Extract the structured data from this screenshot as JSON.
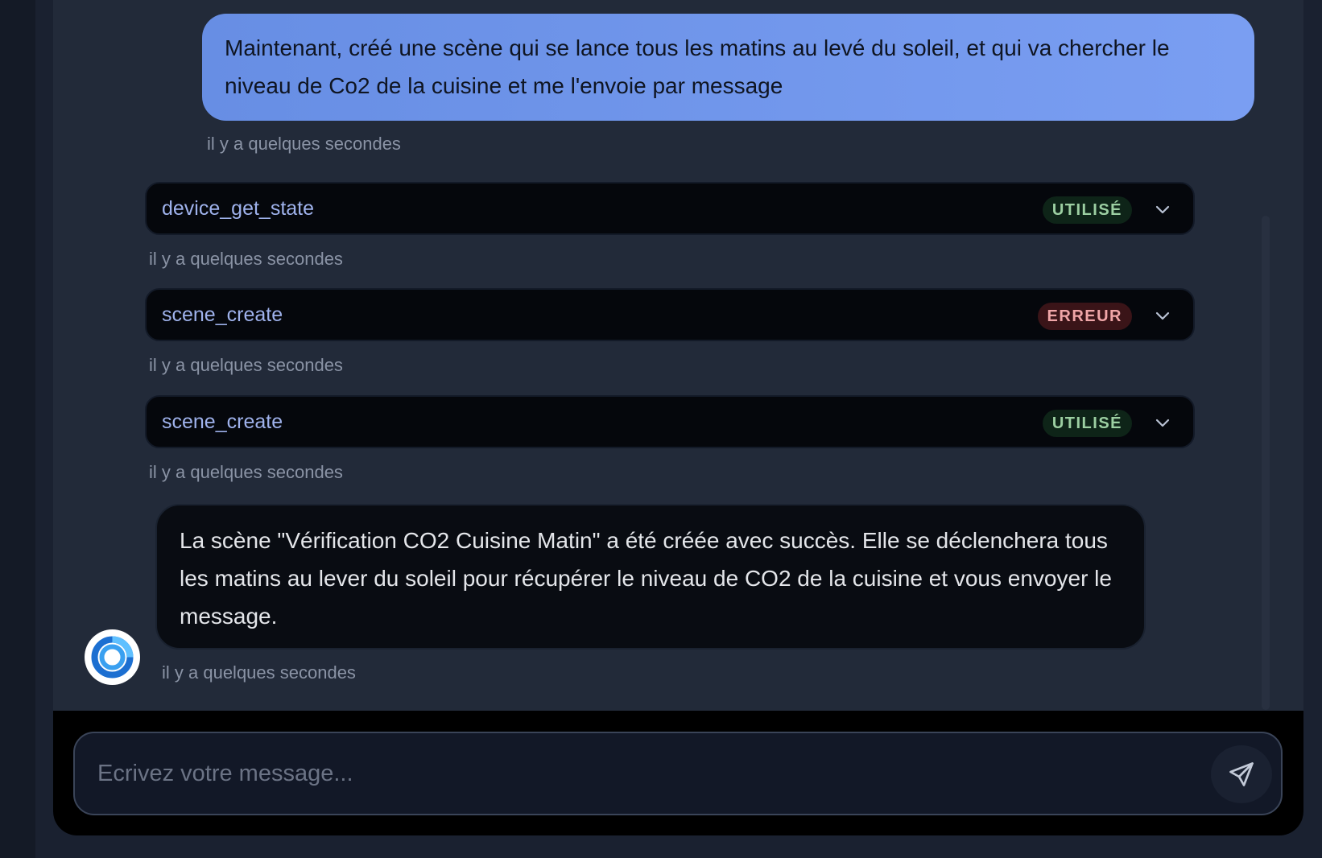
{
  "messages": {
    "user_text": "Maintenant, créé une scène qui se lance tous les matins au levé du soleil, et qui va chercher le niveau de Co2 de la cuisine et me l'envoie par message",
    "user_time": "il y a quelques secondes",
    "tools": [
      {
        "name": "device_get_state",
        "status": "UTILISÉ",
        "time": "il y a quelques secondes"
      },
      {
        "name": "scene_create",
        "status": "ERREUR",
        "time": "il y a quelques secondes"
      },
      {
        "name": "scene_create",
        "status": "UTILISÉ",
        "time": "il y a quelques secondes"
      }
    ],
    "assistant_text": "La scène \"Vérification CO2 Cuisine Matin\" a été créée avec succès. Elle se déclenchera tous les matins au lever du soleil pour récupérer le niveau de CO2 de la cuisine et vous envoyer le message.",
    "assistant_time": "il y a quelques secondes"
  },
  "composer": {
    "placeholder": "Ecrivez votre message..."
  },
  "icons": {
    "chevron": "chevron-down-icon",
    "send": "send-icon",
    "avatar": "assistant-logo-icon"
  },
  "colors": {
    "user_bubble": "#6f95ea",
    "status_ok": "#9ccfa2",
    "status_error": "#f0a6a8",
    "tool_name": "#9fb2ec"
  }
}
